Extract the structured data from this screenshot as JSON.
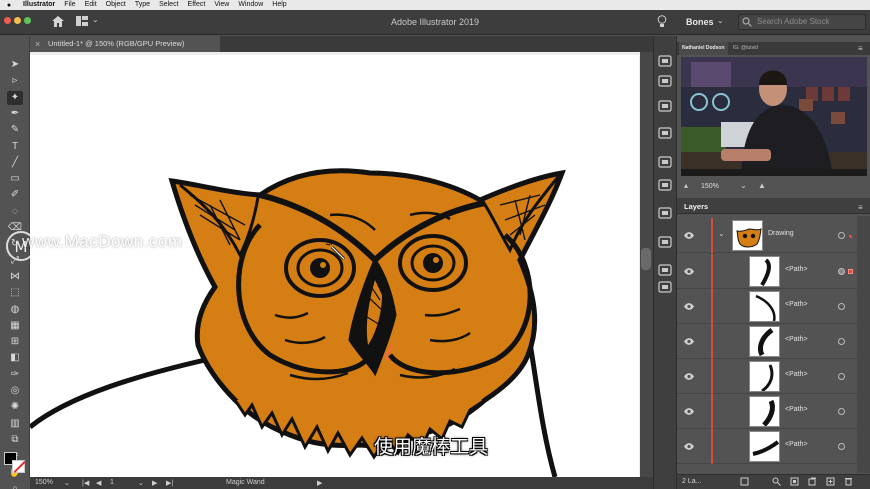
{
  "menubar": {
    "app_name": "Illustrator",
    "items": [
      "File",
      "Edit",
      "Object",
      "Type",
      "Select",
      "Effect",
      "View",
      "Window",
      "Help"
    ]
  },
  "appbar": {
    "title": "Adobe Illustrator 2019",
    "workspace": "Bones",
    "search_placeholder": "Search Adobe Stock"
  },
  "document_tab": {
    "label": "Untitled-1* @ 150% (RGB/GPU Preview)"
  },
  "toolbar": {
    "tools": [
      "selection-tool",
      "direct-selection-tool",
      "magic-wand-tool",
      "pen-tool",
      "curvature-tool",
      "type-tool",
      "line-segment-tool",
      "rectangle-tool",
      "paintbrush-tool",
      "shaper-tool",
      "eraser-tool",
      "rotate-tool",
      "scale-tool",
      "width-tool",
      "free-transform-tool",
      "shape-builder-tool",
      "perspective-grid-tool",
      "mesh-tool",
      "gradient-tool",
      "eyedropper-tool",
      "blend-tool",
      "symbol-sprayer-tool",
      "column-graph-tool",
      "artboard-tool",
      "slice-tool",
      "hand-tool",
      "zoom-tool"
    ],
    "active_tool": "magic-wand-tool"
  },
  "statusbar": {
    "zoom": "150%",
    "artboard": "1",
    "tool_name": "Magic Wand"
  },
  "video_panel": {
    "tab_name": "Nathaniel Dodson",
    "tab_handle": "IG: @tutvid",
    "zoom": "150%"
  },
  "layers_panel": {
    "title": "Layers",
    "rows": [
      {
        "name": "Drawing",
        "type": "layer"
      },
      {
        "name": "<Path>",
        "type": "path"
      },
      {
        "name": "<Path>",
        "type": "path"
      },
      {
        "name": "<Path>",
        "type": "path"
      },
      {
        "name": "<Path>",
        "type": "path"
      },
      {
        "name": "<Path>",
        "type": "path"
      },
      {
        "name": "<Path>",
        "type": "path"
      }
    ],
    "count_label": "2 La..."
  },
  "overlays": {
    "watermark": "www.MacDown.com",
    "subtitle": "使用魔棒工具"
  },
  "colors": {
    "owl_orange": "#d57e14",
    "accent_red": "#d64b3c"
  }
}
